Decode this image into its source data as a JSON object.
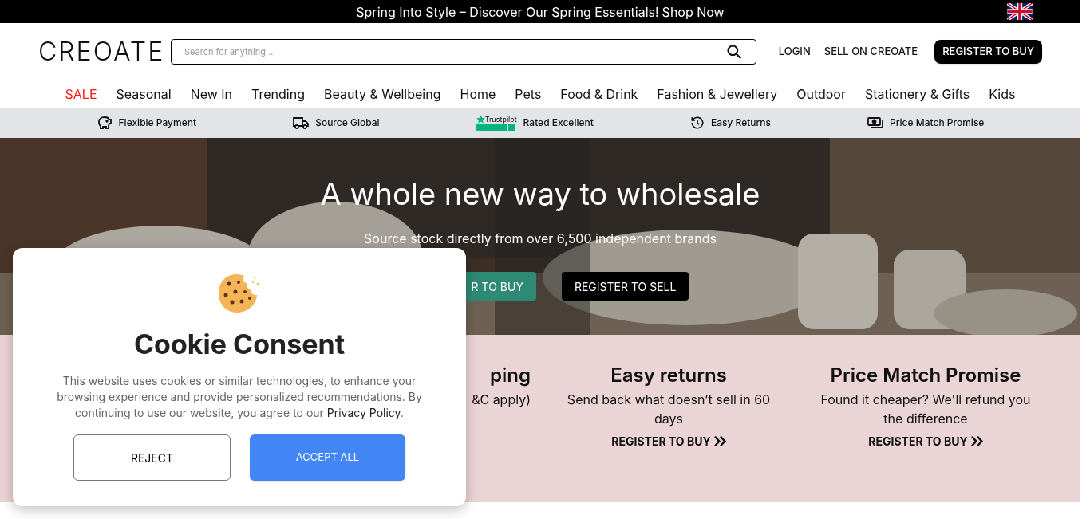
{
  "announcement": {
    "text": "Spring Into Style – Discover Our Spring Essentials!",
    "link": "Shop Now"
  },
  "header": {
    "logo": "CREOATE",
    "search": {
      "placeholder": "Search for anything..."
    },
    "links": [
      "LOGIN",
      "SELL ON CREOATE"
    ],
    "register_button": "REGISTER TO BUY"
  },
  "nav": [
    {
      "label": "SALE",
      "kind": "sale"
    },
    {
      "label": "Seasonal",
      "kind": "normal"
    },
    {
      "label": "New In",
      "kind": "normal"
    },
    {
      "label": "Trending",
      "kind": "normal"
    },
    {
      "label": "Beauty & Wellbeing",
      "kind": "normal"
    },
    {
      "label": "Home",
      "kind": "normal"
    },
    {
      "label": "Pets",
      "kind": "normal"
    },
    {
      "label": "Food & Drink",
      "kind": "normal"
    },
    {
      "label": "Fashion & Jewellery",
      "kind": "normal"
    },
    {
      "label": "Outdoor",
      "kind": "normal"
    },
    {
      "label": "Stationery & Gifts",
      "kind": "normal"
    },
    {
      "label": "Kids",
      "kind": "normal"
    }
  ],
  "benefits": [
    {
      "kind": "piggy",
      "label": "Flexible Payment"
    },
    {
      "kind": "truck",
      "label": "Source Global"
    },
    {
      "kind": "trustpilot",
      "badge": "Trustpilot",
      "label": "Rated Excellent"
    },
    {
      "kind": "returns",
      "label": "Easy Returns"
    },
    {
      "kind": "money",
      "label": "Price Match Promise"
    }
  ],
  "hero": {
    "title": "A whole new way to wholesale",
    "subtitle": "Source stock directly from over 6,500 independent brands",
    "buy_button": "R TO BUY",
    "sell_button": "REGISTER TO SELL"
  },
  "features": [
    {
      "kind": "partial",
      "title": "ping",
      "text": "&C apply)"
    },
    {
      "kind": "full",
      "title": "Easy returns",
      "text": "Send back what doesn’t sell in 60 days",
      "link": "REGISTER TO BUY"
    },
    {
      "kind": "full",
      "title": "Price Match Promise",
      "text": "Found it cheaper? We'll refund you the difference",
      "link": "REGISTER TO BUY"
    }
  ],
  "cookie_dialog": {
    "title": "Cookie Consent",
    "text": "This website uses cookies or similar technologies, to enhance your browsing experience and provide personalized recommendations. By continuing to use our website, you agree to our",
    "link": "Privacy Policy",
    "text_end": ".",
    "reject": "REJECT",
    "accept": "ACCEPT ALL"
  }
}
